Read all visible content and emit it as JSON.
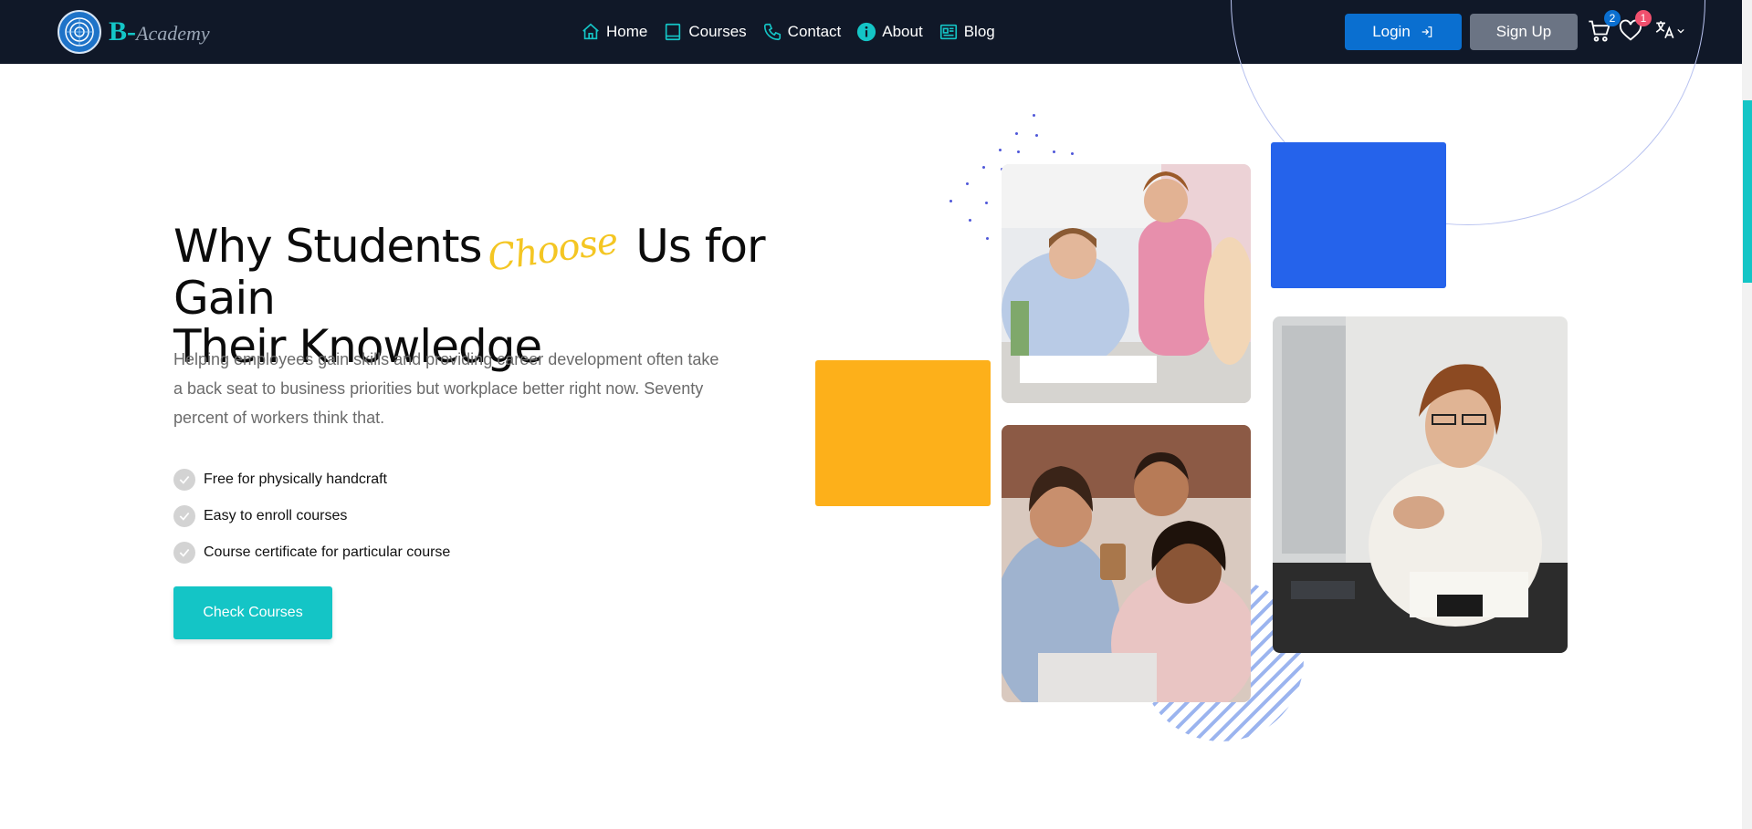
{
  "brand": {
    "initial": "B-",
    "name": "Academy",
    "logo_icon": "academy-logo-icon"
  },
  "nav": {
    "items": [
      {
        "label": "Home",
        "icon": "home-icon"
      },
      {
        "label": "Courses",
        "icon": "book-icon"
      },
      {
        "label": "Contact",
        "icon": "phone-icon"
      },
      {
        "label": "About",
        "icon": "info-icon"
      },
      {
        "label": "Blog",
        "icon": "blog-icon"
      }
    ]
  },
  "header_actions": {
    "login_label": "Login",
    "signup_label": "Sign Up",
    "cart_count": "2",
    "wishlist_count": "1",
    "language_icon": "translate-icon"
  },
  "hero": {
    "title_part1": "Why Students",
    "title_script": "Choose",
    "title_part2": "Us for Gain",
    "title_line2": "Their Knowledge",
    "description": "Helping employees gain skills and providing career development often take a back seat to business priorities but workplace better right now. Seventy percent of workers think that.",
    "features": [
      "Free for physically handcraft",
      "Easy to enroll courses",
      "Course certificate for particular course"
    ],
    "cta_label": "Check Courses"
  },
  "colors": {
    "header_bg": "#101828",
    "accent": "#14c5c6",
    "login_bg": "#0a6fd0",
    "signup_bg": "#6b7484",
    "blue_block": "#2563eb",
    "yellow_block": "#fdb01a",
    "script_text": "#f4c623",
    "cart_badge": "#0a6fd0",
    "wishlist_badge": "#f0506e"
  }
}
